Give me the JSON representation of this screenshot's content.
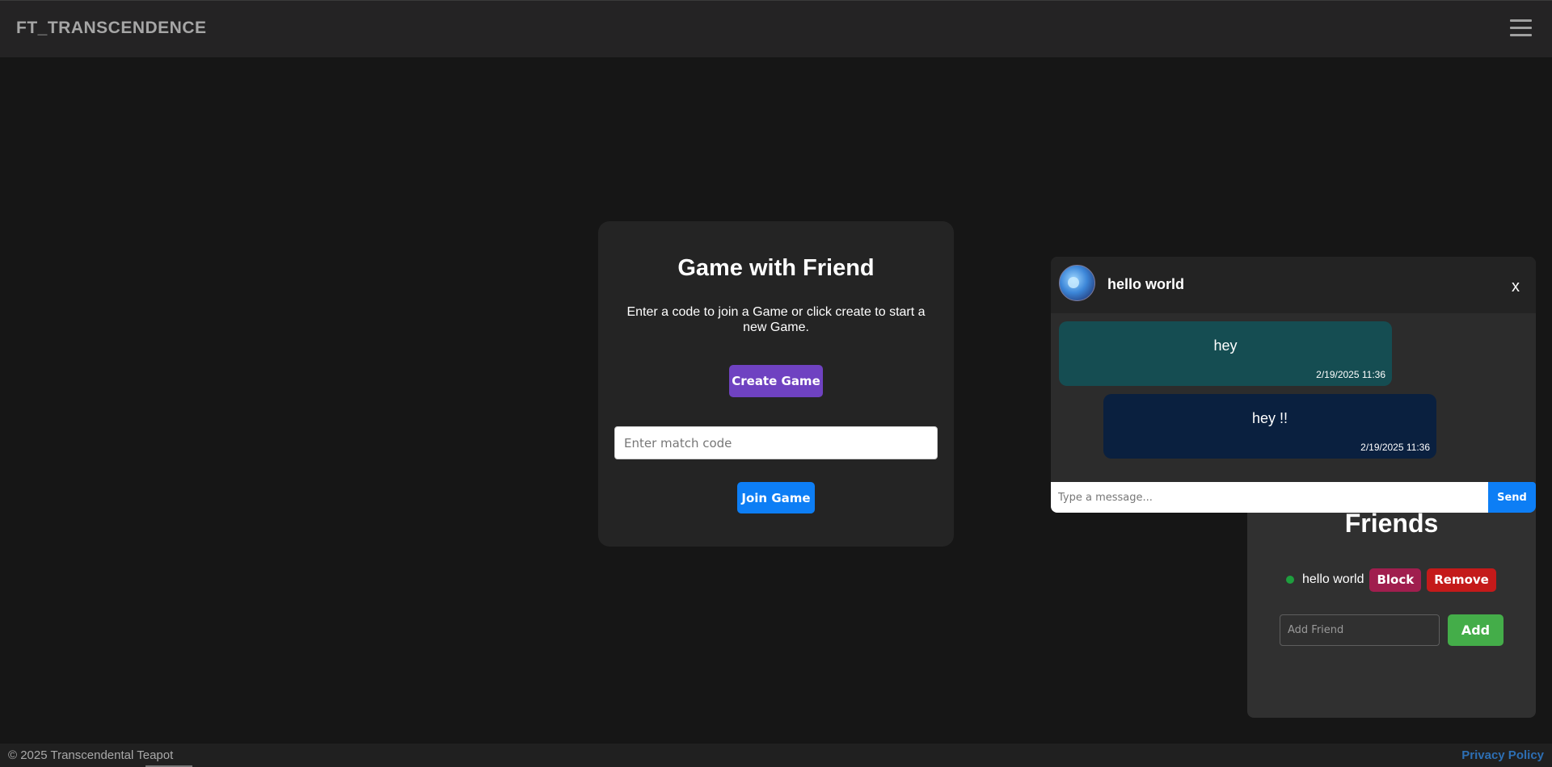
{
  "header": {
    "brand": "FT_TRANSCENDENCE",
    "menu_icon": "hamburger-menu-icon"
  },
  "game": {
    "title": "Game with Friend",
    "description": "Enter a code to join a Game or click create to start a new Game.",
    "create_label": "Create Game",
    "match_code_placeholder": "Enter match code",
    "join_label": "Join Game"
  },
  "chat": {
    "user_name": "hello world",
    "close_label": "x",
    "messages": [
      {
        "text": "hey",
        "time": "2/19/2025 11:36",
        "color": "#154d52"
      },
      {
        "text": "hey !!",
        "time": "2/19/2025 11:36",
        "color": "#0a203f"
      }
    ],
    "input_placeholder": "Type a message...",
    "send_label": "Send"
  },
  "friends": {
    "title": "Friends",
    "items": [
      {
        "name": "hello world",
        "status": "online",
        "block_label": "Block",
        "remove_label": "Remove"
      }
    ],
    "add_placeholder": "Add Friend",
    "add_label": "Add"
  },
  "footer": {
    "copyright": "© 2025 Transcendental Teapot",
    "privacy": "Privacy Policy"
  },
  "colors": {
    "accent_blue": "#0d7ef5",
    "create_purple": "#6f42c1",
    "online_green": "#1e9e3e",
    "add_green": "#44ad49",
    "block_red": "#a01e4e",
    "remove_red": "#c41a1a"
  }
}
